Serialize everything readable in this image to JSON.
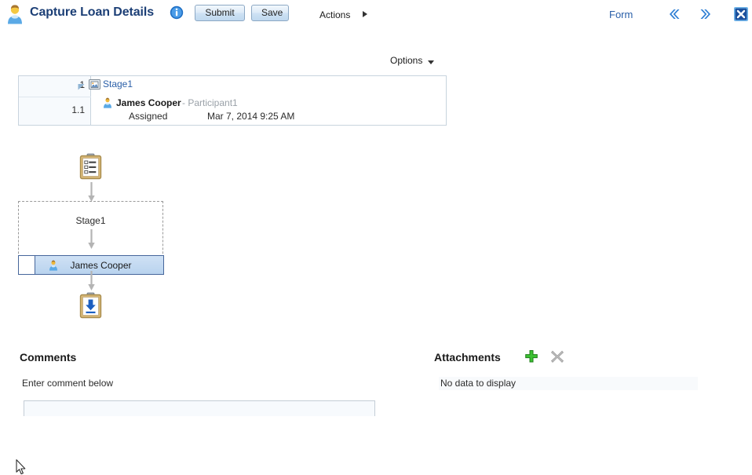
{
  "header": {
    "avatar_icon": "user-avatar-icon",
    "title": "Capture Loan Details",
    "info_icon": "info-icon",
    "submit_label": "Submit",
    "save_label": "Save",
    "actions_label": "Actions",
    "actions_arrow_icon": "triangle-right-icon",
    "form_label": "Form",
    "prev_icon": "chevron-left-icon",
    "next_icon": "chevron-right-icon",
    "close_icon": "close-window-icon"
  },
  "toolbar": {
    "options_label": "Options",
    "options_caret_icon": "caret-down-icon"
  },
  "history": {
    "rows": [
      {
        "number": "1",
        "twisty_icon": "disclosure-expanded-icon",
        "icon": "stage-icon",
        "label": "Stage1"
      },
      {
        "number": "1.1",
        "icon": "participant-person-icon",
        "name": "James Cooper",
        "role": "- Participant1",
        "status": "Assigned",
        "date": "Mar 7, 2014 9:25 AM"
      }
    ]
  },
  "diagram": {
    "start_icon": "clipboard-checklist-icon",
    "end_icon": "clipboard-download-icon",
    "stage_label": "Stage1",
    "participant_icon": "participant-person-icon",
    "participant_name": "James Cooper",
    "cursor_icon": "mouse-pointer-icon"
  },
  "comments": {
    "title": "Comments",
    "hint": "Enter comment below",
    "input_value": "",
    "input_placeholder": ""
  },
  "attachments": {
    "title": "Attachments",
    "add_icon": "plus-green-icon",
    "delete_icon": "cross-gray-icon",
    "empty_message": "No data to display"
  },
  "colors": {
    "title_blue": "#1c3f76",
    "link_blue": "#2a5fa8",
    "button_border": "#8ca8c4",
    "selected_fill": "#b9d3ee",
    "selected_border": "#46669b",
    "add_green": "#33a532",
    "delete_gray": "#b3b3b3"
  }
}
